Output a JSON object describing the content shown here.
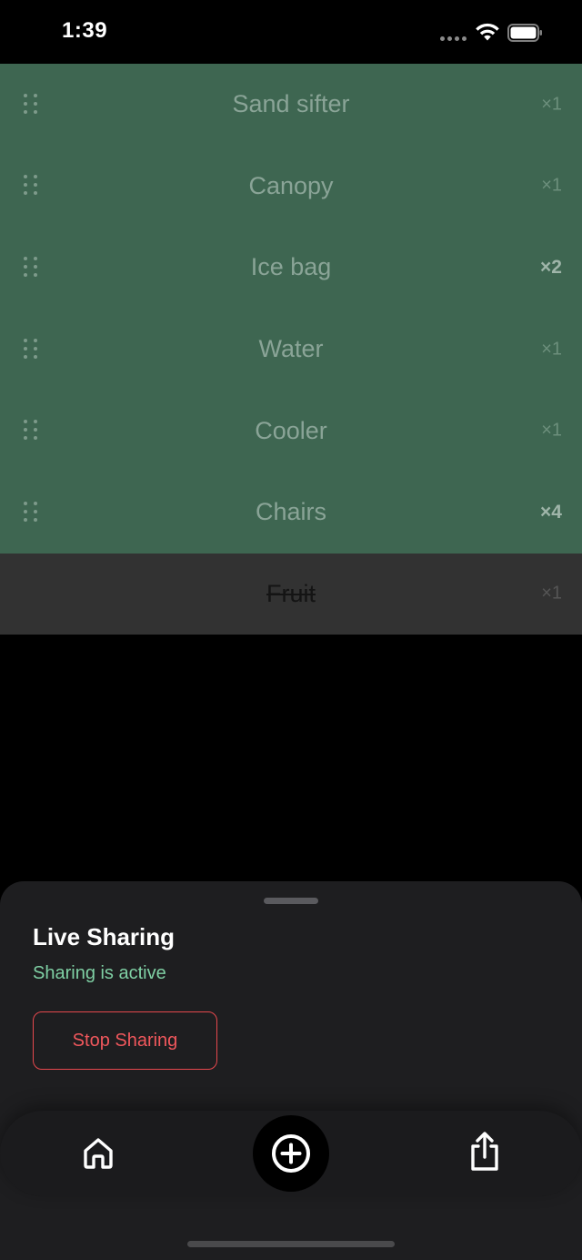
{
  "status_bar": {
    "time": "1:39",
    "icons": [
      "cellular-dots-icon",
      "wifi-icon",
      "battery-icon"
    ]
  },
  "list": {
    "items": [
      {
        "name": "Sand sifter",
        "qty": "×1",
        "highlight_qty": false,
        "completed": false
      },
      {
        "name": "Canopy",
        "qty": "×1",
        "highlight_qty": false,
        "completed": false
      },
      {
        "name": "Ice bag",
        "qty": "×2",
        "highlight_qty": true,
        "completed": false
      },
      {
        "name": "Water",
        "qty": "×1",
        "highlight_qty": false,
        "completed": false
      },
      {
        "name": "Cooler",
        "qty": "×1",
        "highlight_qty": false,
        "completed": false
      },
      {
        "name": "Chairs",
        "qty": "×4",
        "highlight_qty": true,
        "completed": false
      },
      {
        "name": "Fruit",
        "qty": "×1",
        "highlight_qty": false,
        "completed": true
      }
    ]
  },
  "sheet": {
    "title": "Live Sharing",
    "status": "Sharing is active",
    "stop_label": "Stop Sharing"
  },
  "tab_bar": {
    "items": [
      "home-icon",
      "add-circle-icon",
      "share-icon"
    ]
  },
  "colors": {
    "active_row": "#3e6651",
    "completed_row": "#323232",
    "sheet_bg": "#1e1e20",
    "status_green": "#7fd0a4",
    "stop_red": "#e5484d"
  }
}
